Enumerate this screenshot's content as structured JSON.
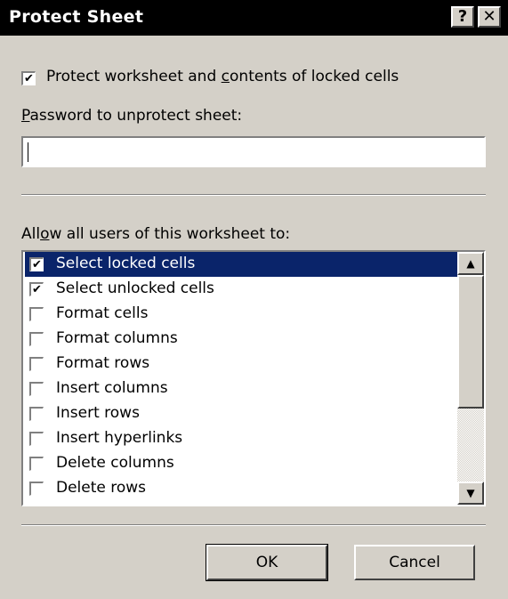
{
  "window": {
    "title": "Protect Sheet",
    "help_glyph": "?",
    "close_glyph": "✕"
  },
  "protect_option": {
    "checked": true,
    "label_before": "Protect worksheet and ",
    "label_accel": "c",
    "label_after": "ontents of locked cells"
  },
  "password": {
    "label_accel": "P",
    "label_rest": "assword to unprotect sheet:",
    "value": ""
  },
  "permissions": {
    "label_before": "All",
    "label_accel": "o",
    "label_after": "w all users of this worksheet to:",
    "items": [
      {
        "label": "Select locked cells",
        "checked": true,
        "selected": true
      },
      {
        "label": "Select unlocked cells",
        "checked": true,
        "selected": false
      },
      {
        "label": "Format cells",
        "checked": false,
        "selected": false
      },
      {
        "label": "Format columns",
        "checked": false,
        "selected": false
      },
      {
        "label": "Format rows",
        "checked": false,
        "selected": false
      },
      {
        "label": "Insert columns",
        "checked": false,
        "selected": false
      },
      {
        "label": "Insert rows",
        "checked": false,
        "selected": false
      },
      {
        "label": "Insert hyperlinks",
        "checked": false,
        "selected": false
      },
      {
        "label": "Delete columns",
        "checked": false,
        "selected": false
      },
      {
        "label": "Delete rows",
        "checked": false,
        "selected": false
      }
    ]
  },
  "buttons": {
    "ok": "OK",
    "cancel": "Cancel"
  }
}
